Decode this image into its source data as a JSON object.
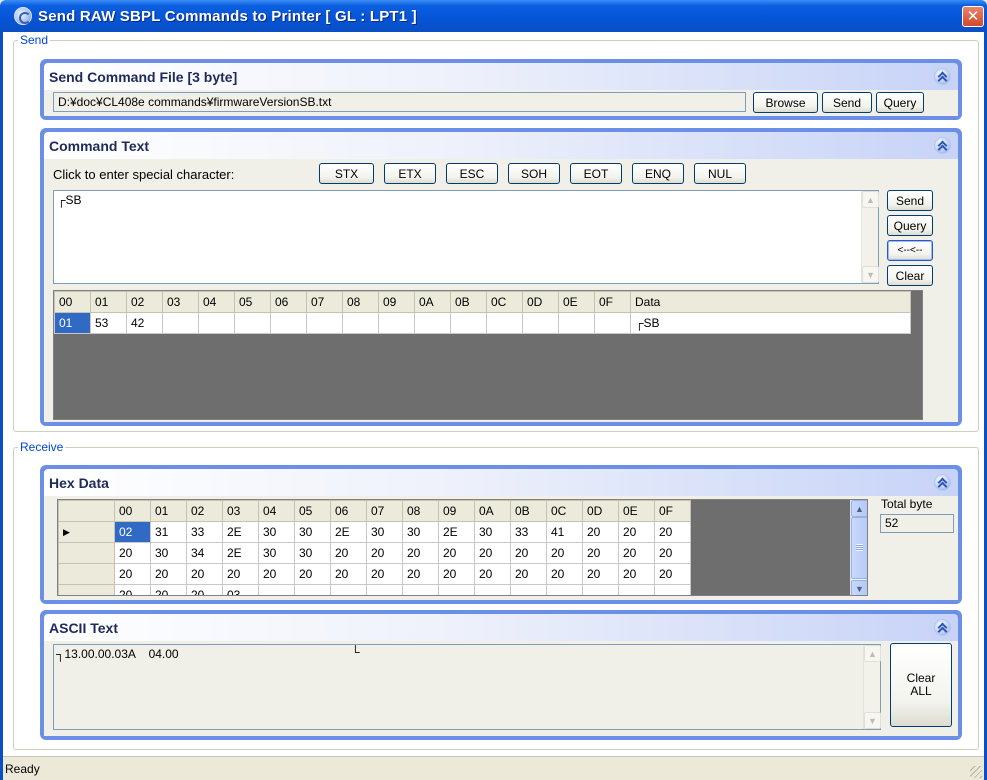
{
  "window": {
    "title": "Send RAW SBPL Commands to Printer [ GL : LPT1 ]",
    "close_glyph": "✕"
  },
  "send_group": {
    "label": "Send",
    "file_panel": {
      "title": "Send Command File [3 byte]",
      "path": "D:¥doc¥CL408e commands¥firmwareVersionSB.txt",
      "browse_label": "Browse",
      "send_label": "Send",
      "query_label": "Query"
    },
    "text_panel": {
      "title": "Command Text",
      "special_prompt": "Click to enter special character:",
      "special_chars": [
        "STX",
        "ETX",
        "ESC",
        "SOH",
        "EOT",
        "ENQ",
        "NUL"
      ],
      "command_text": "┌SB",
      "side_buttons": {
        "send": "Send",
        "query": "Query",
        "convert": "<--<--",
        "clear": "Clear"
      },
      "grid": {
        "headers": [
          "00",
          "01",
          "02",
          "03",
          "04",
          "05",
          "06",
          "07",
          "08",
          "09",
          "0A",
          "0B",
          "0C",
          "0D",
          "0E",
          "0F",
          "Data"
        ],
        "rows": [
          [
            "01",
            "53",
            "42",
            "",
            "",
            "",
            "",
            "",
            "",
            "",
            "",
            "",
            "",
            "",
            "",
            "",
            "┌SB"
          ]
        ]
      }
    }
  },
  "receive_group": {
    "label": "Receive",
    "hex_panel": {
      "title": "Hex Data",
      "total_label": "Total byte",
      "total_value": "52",
      "headers": [
        "00",
        "01",
        "02",
        "03",
        "04",
        "05",
        "06",
        "07",
        "08",
        "09",
        "0A",
        "0B",
        "0C",
        "0D",
        "0E",
        "0F"
      ],
      "rows": [
        [
          "02",
          "31",
          "33",
          "2E",
          "30",
          "30",
          "2E",
          "30",
          "30",
          "2E",
          "30",
          "33",
          "41",
          "20",
          "20",
          "20"
        ],
        [
          "20",
          "30",
          "34",
          "2E",
          "30",
          "30",
          "20",
          "20",
          "20",
          "20",
          "20",
          "20",
          "20",
          "20",
          "20",
          "20"
        ],
        [
          "20",
          "20",
          "20",
          "20",
          "20",
          "20",
          "20",
          "20",
          "20",
          "20",
          "20",
          "20",
          "20",
          "20",
          "20",
          "20"
        ],
        [
          "20",
          "20",
          "20",
          "03",
          "",
          "",
          "",
          "",
          "",
          "",
          "",
          "",
          "",
          "",
          "",
          ""
        ]
      ],
      "row_indicator": "▶"
    },
    "ascii_panel": {
      "title": "ASCII Text",
      "text_main": "┐13.00.00.03A    04.00",
      "text_end": "└",
      "clear_all_line1": "Clear",
      "clear_all_line2": "ALL"
    }
  },
  "status": {
    "text": "Ready"
  },
  "colors": {
    "title_bar": "#0554d6",
    "panel_border": "#6b8fe6",
    "selection": "#316ac5",
    "grid_empty": "#6e6e6e"
  }
}
